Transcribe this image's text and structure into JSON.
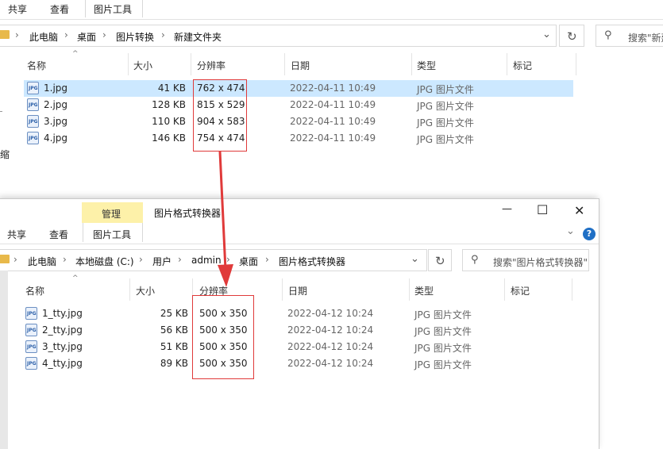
{
  "window1": {
    "ribbon_tabs": [
      "共享",
      "查看",
      "图片工具"
    ],
    "side_label": "缩",
    "breadcrumb": [
      "此电脑",
      "桌面",
      "图片转换",
      "新建文件夹"
    ],
    "search_placeholder": "搜索\"新建",
    "columns": [
      "名称",
      "大小",
      "分辨率",
      "日期",
      "类型",
      "标记"
    ],
    "files": [
      {
        "name": "1.jpg",
        "size": "41 KB",
        "resolution": "762 x 474",
        "date": "2022-04-11 10:49",
        "type": "JPG 图片文件",
        "selected": true
      },
      {
        "name": "2.jpg",
        "size": "128 KB",
        "resolution": "815 x 529",
        "date": "2022-04-11 10:49",
        "type": "JPG 图片文件",
        "selected": false
      },
      {
        "name": "3.jpg",
        "size": "110 KB",
        "resolution": "904 x 583",
        "date": "2022-04-11 10:49",
        "type": "JPG 图片文件",
        "selected": false
      },
      {
        "name": "4.jpg",
        "size": "146 KB",
        "resolution": "754 x 474",
        "date": "2022-04-11 10:49",
        "type": "JPG 图片文件",
        "selected": false
      }
    ]
  },
  "window2": {
    "title": "图片格式转换器",
    "manage_tab": "管理",
    "ribbon_tabs": [
      "共享",
      "查看",
      "图片工具"
    ],
    "breadcrumb": [
      "此电脑",
      "本地磁盘 (C:)",
      "用户",
      "admin",
      "桌面",
      "图片格式转换器"
    ],
    "search_placeholder": "搜索\"图片格式转换器\"",
    "columns": [
      "名称",
      "大小",
      "分辨率",
      "日期",
      "类型",
      "标记"
    ],
    "files": [
      {
        "name": "1_tty.jpg",
        "size": "25 KB",
        "resolution": "500 x 350",
        "date": "2022-04-12 10:24",
        "type": "JPG 图片文件"
      },
      {
        "name": "2_tty.jpg",
        "size": "56 KB",
        "resolution": "500 x 350",
        "date": "2022-04-12 10:24",
        "type": "JPG 图片文件"
      },
      {
        "name": "3_tty.jpg",
        "size": "51 KB",
        "resolution": "500 x 350",
        "date": "2022-04-12 10:24",
        "type": "JPG 图片文件"
      },
      {
        "name": "4_tty.jpg",
        "size": "89 KB",
        "resolution": "500 x 350",
        "date": "2022-04-12 10:24",
        "type": "JPG 图片文件"
      }
    ]
  },
  "icons": {
    "file_icon_text": "JPG",
    "chevron_down": "⌄",
    "refresh": "↻",
    "search": "⚲",
    "minimize": "—",
    "maximize": "☐",
    "close": "✕",
    "help": "?",
    "sort_up": "^"
  },
  "colors": {
    "highlight_box": "#e03a3a",
    "selection": "#cce8ff",
    "manage_tab": "#fdf1a9",
    "arrow": "#e03a3a"
  }
}
